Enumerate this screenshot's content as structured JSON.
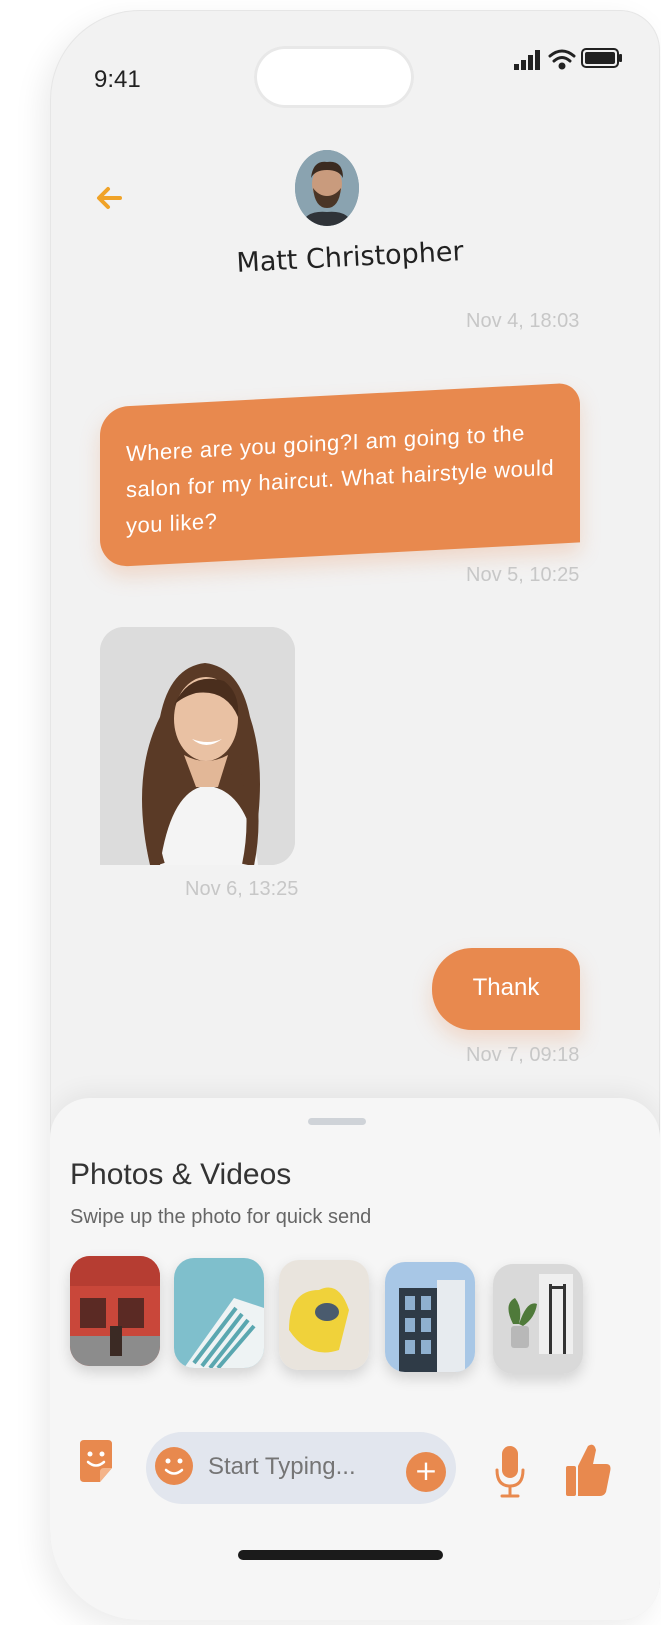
{
  "status_bar": {
    "time": "9:41"
  },
  "header": {
    "contact_name": "Matt Christopher",
    "back_icon": "arrow-left-icon",
    "accent_color": "#f0a328"
  },
  "messages": [
    {
      "type": "timestamp",
      "text": "Nov 4, 18:03"
    },
    {
      "type": "outgoing-text",
      "text": "Where are you going?I am going to the salon for my haircut. What hairstyle would you like?",
      "time": "Nov 5, 10:25"
    },
    {
      "type": "incoming-photo",
      "time": "Nov 6, 13:25"
    },
    {
      "type": "outgoing-text",
      "text": "Thank",
      "time": "Nov 7, 09:18"
    }
  ],
  "media_sheet": {
    "title": "Photos & Videos",
    "subtitle": "Swipe up the photo for quick send",
    "thumbnails": [
      "red-storefront",
      "teal-building",
      "yellow-chair",
      "modern-building",
      "interior-plant"
    ]
  },
  "composer": {
    "placeholder": "Start Typing...",
    "plus_label": "+",
    "icons": [
      "sticker-icon",
      "emoji-icon",
      "plus-icon",
      "microphone-icon",
      "thumbs-up-icon"
    ]
  },
  "colors": {
    "bubble": "#e8894e",
    "background": "#f2f2f2",
    "timestamp": "#c7c7c7"
  }
}
